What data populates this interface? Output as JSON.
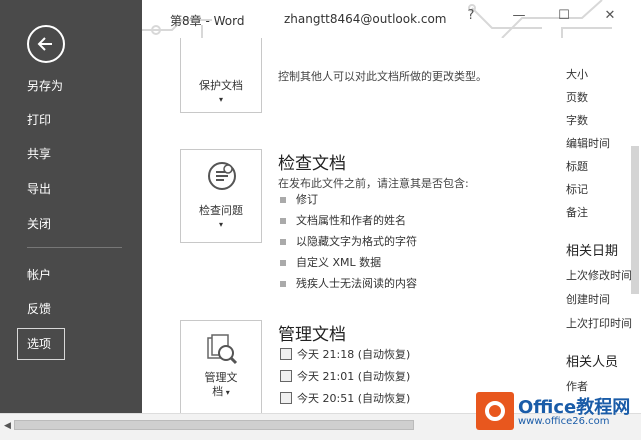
{
  "window": {
    "title": "第8章 - Word",
    "account": "zhangtt8464@outlook.com",
    "help": "?",
    "minimize": "—",
    "maximize": "☐",
    "close": "✕"
  },
  "sidebar": {
    "items": [
      {
        "label": "另存为"
      },
      {
        "label": "打印"
      },
      {
        "label": "共享"
      },
      {
        "label": "导出"
      },
      {
        "label": "关闭"
      },
      {
        "label": "帐户"
      },
      {
        "label": "反馈"
      },
      {
        "label": "选项"
      }
    ]
  },
  "protect": {
    "desc_partial": "控制其他人可以对此文档所做的更改类型。",
    "tile_label": "保护文档"
  },
  "inspect": {
    "title": "检查文档",
    "desc": "在发布此文件之前，请注意其是否包含:",
    "tile_label": "检查问题",
    "bullets": [
      "修订",
      "文档属性和作者的姓名",
      "以隐藏文字为格式的字符",
      "自定义 XML 数据",
      "残疾人士无法阅读的内容"
    ]
  },
  "manage": {
    "title": "管理文档",
    "tile_label_1": "管理文",
    "tile_label_2": "档",
    "versions": [
      "今天 21:18 (自动恢复)",
      "今天 21:01 (自动恢复)",
      "今天 20:51 (自动恢复)"
    ]
  },
  "properties": {
    "items": [
      "大小",
      "页数",
      "字数",
      "编辑时间",
      "标题",
      "标记",
      "备注"
    ],
    "related_dates_head": "相关日期",
    "dates": [
      "上次修改时间",
      "创建时间",
      "上次打印时间"
    ],
    "related_people_head": "相关人员",
    "people": [
      "作者"
    ]
  },
  "watermark": {
    "text": "Office教程网",
    "sub": "www.office26.com"
  }
}
